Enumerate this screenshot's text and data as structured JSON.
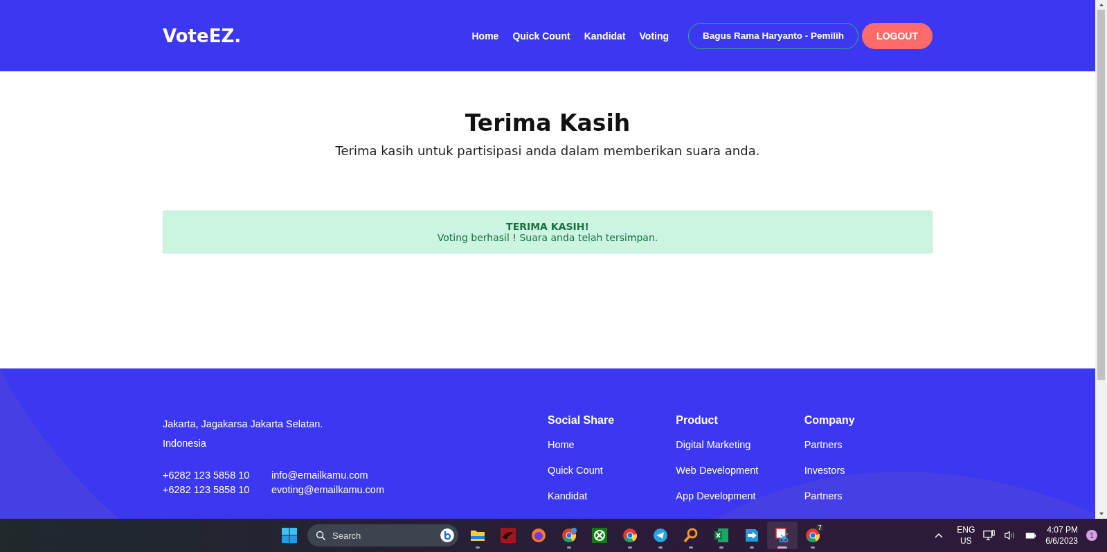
{
  "navbar": {
    "brand": "VoteEZ.",
    "links": [
      {
        "label": "Home"
      },
      {
        "label": "Quick Count"
      },
      {
        "label": "Kandidat"
      },
      {
        "label": "Voting"
      }
    ],
    "user_button": "Bagus Rama Haryanto - Pemilih",
    "logout_button": "LOGOUT"
  },
  "hero": {
    "title": "Terima Kasih",
    "subtitle": "Terima kasih untuk partisipasi anda dalam memberikan suara anda."
  },
  "alert": {
    "title": "TERIMA KASIH!",
    "message": "Voting berhasil ! Suara anda telah tersimpan."
  },
  "footer": {
    "address": [
      "Jakarta, Jagakarsa Jakarta Selatan.",
      "Indonesia"
    ],
    "contacts": [
      {
        "phone": "+6282 123 5858 10",
        "email": "info@emailkamu.com"
      },
      {
        "phone": "+6282 123 5858 10",
        "email": "evoting@emailkamu.com"
      }
    ],
    "columns": [
      {
        "heading": "Social Share",
        "links": [
          "Home",
          "Quick Count",
          "Kandidat"
        ]
      },
      {
        "heading": "Product",
        "links": [
          "Digital Marketing",
          "Web Development",
          "App Development"
        ]
      },
      {
        "heading": "Company",
        "links": [
          "Partners",
          "Investors",
          "Partners"
        ]
      }
    ]
  },
  "taskbar": {
    "search_placeholder": "Search",
    "apps": [
      {
        "kind": "folder",
        "running": true,
        "selected": false
      },
      {
        "kind": "dragon",
        "running": false,
        "selected": false
      },
      {
        "kind": "firefox",
        "running": false,
        "selected": false
      },
      {
        "kind": "chrome-globe",
        "running": true,
        "selected": false
      },
      {
        "kind": "xbox",
        "running": false,
        "selected": false
      },
      {
        "kind": "chrome",
        "running": true,
        "selected": false
      },
      {
        "kind": "telegram",
        "running": true,
        "selected": false
      },
      {
        "kind": "magnifier",
        "running": true,
        "selected": false
      },
      {
        "kind": "excel",
        "running": true,
        "selected": false
      },
      {
        "kind": "arrow",
        "running": true,
        "selected": false
      },
      {
        "kind": "snip",
        "running": true,
        "selected": true
      },
      {
        "kind": "chrome",
        "running": true,
        "selected": false,
        "badge": "7"
      }
    ],
    "language": [
      "ENG",
      "US"
    ],
    "time": "4:07 PM",
    "date": "6/6/2023",
    "notification_count": "1"
  }
}
